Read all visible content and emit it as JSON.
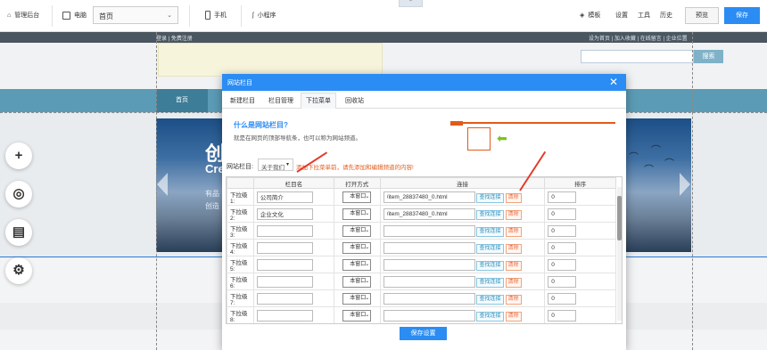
{
  "toolbar": {
    "manage_label": "管理后台",
    "pc_label": "电脑",
    "page_select": "首页",
    "mobile_label": "手机",
    "miniprogram_label": "小程序",
    "template_label": "模板",
    "settings_label": "设置",
    "tools_label": "工具",
    "history_label": "历史",
    "preview_label": "预览",
    "save_label": "保存"
  },
  "site": {
    "topbar_left": "登录 | 免费注册",
    "topbar_right": "设为首页 | 加入收藏 | 在线留言 | 企业位置",
    "search_button": "搜索",
    "nav_home": "首页",
    "banner_title": "创",
    "banner_subtitle": "Cre",
    "banner_line1": "有品",
    "banner_line2": "创造"
  },
  "modal": {
    "title": "网站栏目",
    "close": "✕",
    "tabs": [
      "新建栏目",
      "栏目管理",
      "下拉菜单",
      "回收站"
    ],
    "active_tab": "下拉菜单",
    "help_title": "什么是网站栏目?",
    "help_desc": "就是在网页的顶部导航条，也可以称为网站频道。",
    "field_label": "网站栏目:",
    "field_value": "关于我们",
    "field_hint": "添加下拉菜单前，请先添加和编辑频道的内容!",
    "columns": [
      "栏目名",
      "打开方式",
      "连接",
      "排序"
    ],
    "open_mode": "本窗口",
    "find_link": "查找连接",
    "delete": "清除",
    "rows": [
      {
        "label": "下拉级1:",
        "name": "公司简介",
        "link": "/item_28837480_0.html",
        "order": "0"
      },
      {
        "label": "下拉级2:",
        "name": "企业文化",
        "link": "/item_28837480_0.html",
        "order": "0"
      },
      {
        "label": "下拉级3:",
        "name": "",
        "link": "",
        "order": "0"
      },
      {
        "label": "下拉级4:",
        "name": "",
        "link": "",
        "order": "0"
      },
      {
        "label": "下拉级5:",
        "name": "",
        "link": "",
        "order": "0"
      },
      {
        "label": "下拉级6:",
        "name": "",
        "link": "",
        "order": "0"
      },
      {
        "label": "下拉级7:",
        "name": "",
        "link": "",
        "order": "0"
      },
      {
        "label": "下拉级8:",
        "name": "",
        "link": "",
        "order": "0"
      }
    ],
    "save_button": "保存设置"
  },
  "colors": {
    "accent": "#2b8cf3",
    "warning": "#e25b1b"
  }
}
